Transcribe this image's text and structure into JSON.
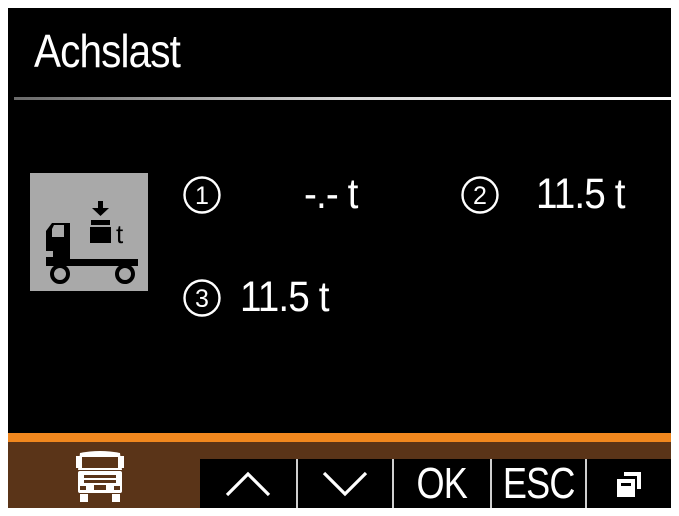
{
  "screen": {
    "title": "Achslast"
  },
  "axles": [
    {
      "number": "1",
      "value": "-.- t"
    },
    {
      "number": "2",
      "value": "11.5 t"
    },
    {
      "number": "3",
      "value": "11.5 t"
    }
  ],
  "icons": {
    "axle_load": "truck-axle-load-icon",
    "home": "truck-front-icon",
    "copy": "copy-pages-icon"
  },
  "softkeys": {
    "up": "up-arrow",
    "down": "down-arrow",
    "ok_label": "OK",
    "esc_label": "ESC",
    "copy": "copy-icon"
  },
  "colors": {
    "accent": "#f0871e",
    "bottom_bar": "#5a3418",
    "icon_box": "#a9a9a9",
    "background": "#000000",
    "text": "#ffffff"
  }
}
